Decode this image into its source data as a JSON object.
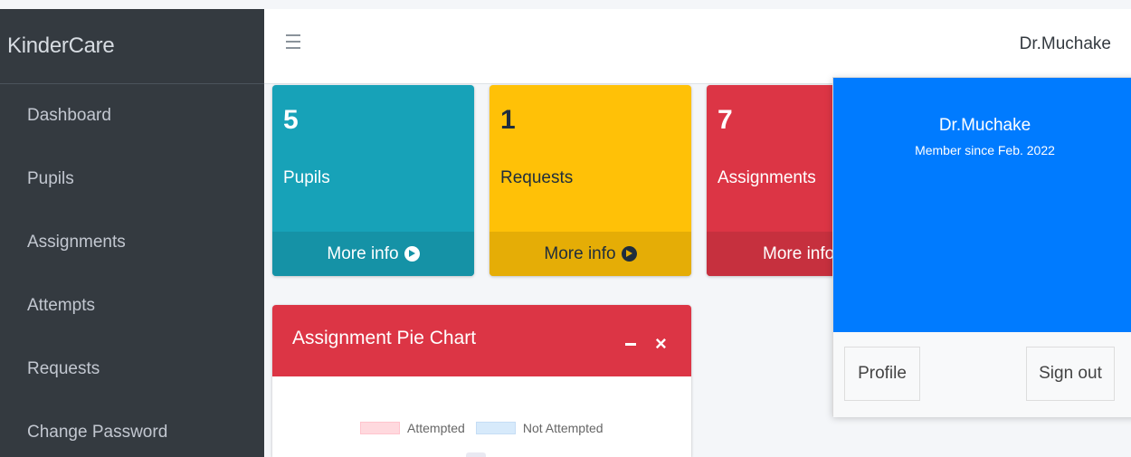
{
  "sidebar": {
    "brand": "KinderCare",
    "items": [
      {
        "label": "Dashboard"
      },
      {
        "label": "Pupils"
      },
      {
        "label": "Assignments"
      },
      {
        "label": "Attempts"
      },
      {
        "label": "Requests"
      },
      {
        "label": "Change Password"
      }
    ]
  },
  "navbar": {
    "menu_icon": "hamburger-icon",
    "user": "Dr.Muchake"
  },
  "boxes": [
    {
      "count": "5",
      "label": "Pupils",
      "footer": "More info",
      "color": "#17a2b8"
    },
    {
      "count": "1",
      "label": "Requests",
      "footer": "More info",
      "color": "#ffc107"
    },
    {
      "count": "7",
      "label": "Assignments",
      "footer": "More info",
      "color": "#dc3545"
    }
  ],
  "card": {
    "title": "Assignment Pie Chart",
    "minimize_icon": "minus-icon",
    "close_icon": "close-icon",
    "legend": [
      "Attempted",
      "Not Attempted"
    ]
  },
  "dropdown": {
    "name": "Dr.Muchake",
    "member_since": "Member since Feb. 2022",
    "profile_label": "Profile",
    "signout_label": "Sign out",
    "header_color": "#007bff"
  }
}
